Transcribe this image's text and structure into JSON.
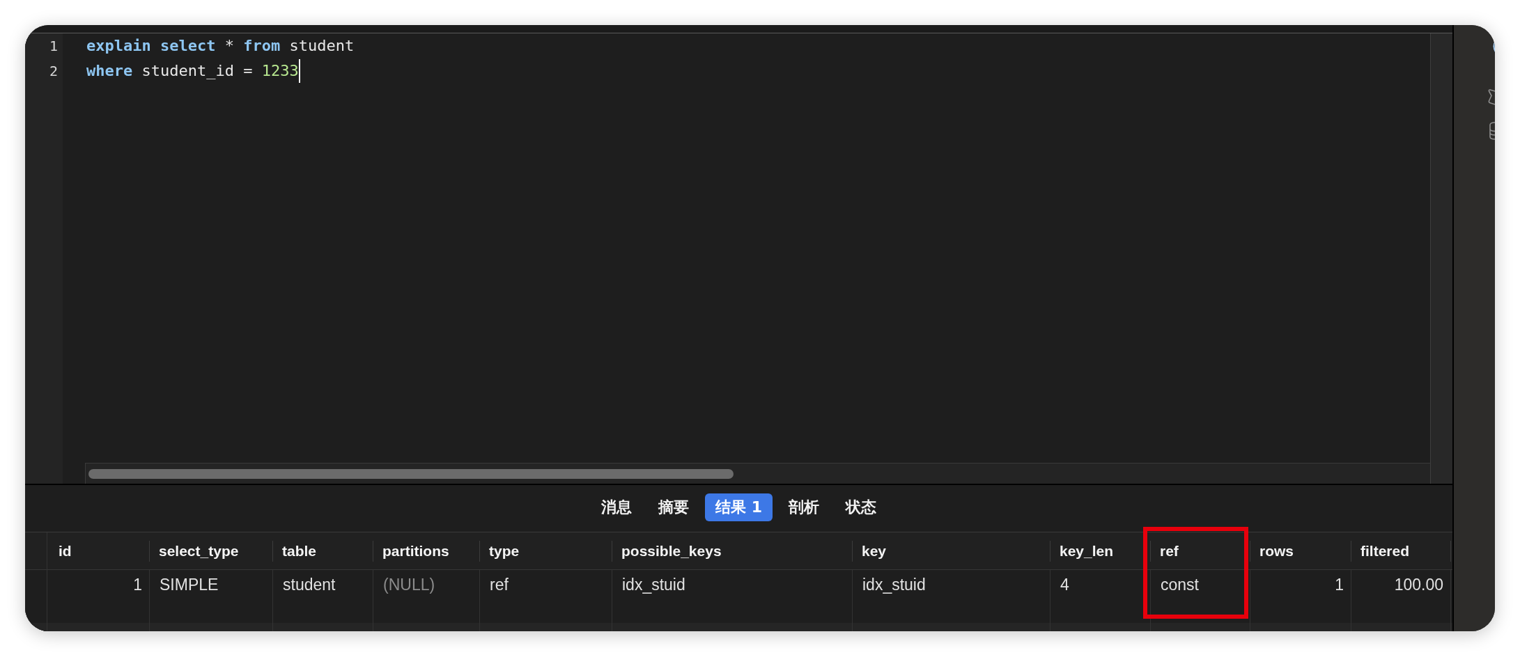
{
  "editor": {
    "lines": [
      {
        "number": "1",
        "cursor": false,
        "tokens": [
          {
            "text": "explain ",
            "kind": "keyword"
          },
          {
            "text": "select",
            "kind": "keyword"
          },
          {
            "text": " * ",
            "kind": "plain"
          },
          {
            "text": "from",
            "kind": "keyword"
          },
          {
            "text": " student",
            "kind": "plain"
          }
        ]
      },
      {
        "number": "2",
        "cursor": true,
        "tokens": [
          {
            "text": "where",
            "kind": "keyword"
          },
          {
            "text": " student_id = ",
            "kind": "plain"
          },
          {
            "text": "1233",
            "kind": "number"
          }
        ]
      }
    ]
  },
  "result_tabs": [
    {
      "label": "消息",
      "selected": false
    },
    {
      "label": "摘要",
      "selected": false
    },
    {
      "label": "结果 1",
      "selected": true
    },
    {
      "label": "剖析",
      "selected": false
    },
    {
      "label": "状态",
      "selected": false
    }
  ],
  "table": {
    "columns": [
      {
        "label": "id",
        "numeric": true,
        "highlighted": false
      },
      {
        "label": "select_type",
        "numeric": false,
        "highlighted": false
      },
      {
        "label": "table",
        "numeric": false,
        "highlighted": false
      },
      {
        "label": "partitions",
        "numeric": false,
        "highlighted": false
      },
      {
        "label": "type",
        "numeric": false,
        "highlighted": false
      },
      {
        "label": "possible_keys",
        "numeric": false,
        "highlighted": false
      },
      {
        "label": "key",
        "numeric": false,
        "highlighted": false
      },
      {
        "label": "key_len",
        "numeric": false,
        "highlighted": false
      },
      {
        "label": "ref",
        "numeric": false,
        "highlighted": true
      },
      {
        "label": "rows",
        "numeric": true,
        "highlighted": false
      },
      {
        "label": "filtered",
        "numeric": true,
        "highlighted": false
      }
    ],
    "rows": [
      {
        "cells": [
          {
            "text": "1",
            "null": false
          },
          {
            "text": "SIMPLE",
            "null": false
          },
          {
            "text": "student",
            "null": false
          },
          {
            "text": "(NULL)",
            "null": true
          },
          {
            "text": "ref",
            "null": false
          },
          {
            "text": "idx_stuid",
            "null": false
          },
          {
            "text": "idx_stuid",
            "null": false
          },
          {
            "text": "4",
            "null": false
          },
          {
            "text": "const",
            "null": false
          },
          {
            "text": "1",
            "null": false
          },
          {
            "text": "100.00",
            "null": false
          }
        ]
      }
    ]
  }
}
